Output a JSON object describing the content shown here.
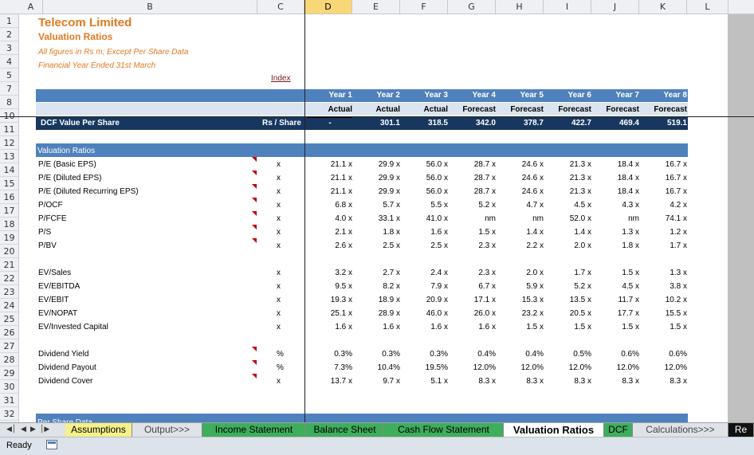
{
  "columns": [
    "A",
    "B",
    "C",
    "D",
    "E",
    "F",
    "G",
    "H",
    "I",
    "J",
    "K",
    "L"
  ],
  "rows": [
    "1",
    "2",
    "3",
    "4",
    "5",
    "7",
    "8",
    "10",
    "11",
    "12",
    "13",
    "14",
    "15",
    "16",
    "17",
    "18",
    "19",
    "20",
    "21",
    "22",
    "23",
    "24",
    "25",
    "26",
    "27",
    "28",
    "29",
    "30",
    "31",
    "32"
  ],
  "header": {
    "company": "Telecom Limited",
    "subtitle": "Valuation Ratios",
    "note1": "All figures in Rs m; Except Per Share Data",
    "note2": "Financial Year Ended 31st March",
    "index_link": "Index"
  },
  "years": [
    "Year 1",
    "Year 2",
    "Year 3",
    "Year 4",
    "Year 5",
    "Year 6",
    "Year 7",
    "Year 8"
  ],
  "types": [
    "Actual",
    "Actual",
    "Actual",
    "Forecast",
    "Forecast",
    "Forecast",
    "Forecast",
    "Forecast"
  ],
  "dcf": {
    "label": "DCF Value Per Share",
    "unit": "Rs / Share",
    "values": [
      "-",
      "301.1",
      "318.5",
      "342.0",
      "378.7",
      "422.7",
      "469.4",
      "519.1"
    ]
  },
  "section1": "Valuation Ratios",
  "section2": "Per Share Data",
  "ratios": [
    {
      "label": "P/E (Basic EPS)",
      "unit": "x",
      "values": [
        "21.1 x",
        "29.9 x",
        "56.0 x",
        "28.7 x",
        "24.6 x",
        "21.3 x",
        "18.4 x",
        "16.7 x"
      ]
    },
    {
      "label": "P/E (Diluted EPS)",
      "unit": "x",
      "values": [
        "21.1 x",
        "29.9 x",
        "56.0 x",
        "28.7 x",
        "24.6 x",
        "21.3 x",
        "18.4 x",
        "16.7 x"
      ]
    },
    {
      "label": "P/E (Diluted Recurring EPS)",
      "unit": "x",
      "values": [
        "21.1 x",
        "29.9 x",
        "56.0 x",
        "28.7 x",
        "24.6 x",
        "21.3 x",
        "18.4 x",
        "16.7 x"
      ]
    },
    {
      "label": "P/OCF",
      "unit": "x",
      "values": [
        "6.8 x",
        "5.7 x",
        "5.5 x",
        "5.2 x",
        "4.7 x",
        "4.5 x",
        "4.3 x",
        "4.2 x"
      ]
    },
    {
      "label": "P/FCFE",
      "unit": "x",
      "values": [
        "4.0 x",
        "33.1 x",
        "41.0 x",
        "nm",
        "nm",
        "52.0 x",
        "nm",
        "74.1 x"
      ]
    },
    {
      "label": "P/S",
      "unit": "x",
      "values": [
        "2.1 x",
        "1.8 x",
        "1.6 x",
        "1.5 x",
        "1.4 x",
        "1.4 x",
        "1.3 x",
        "1.2 x"
      ]
    },
    {
      "label": "P/BV",
      "unit": "x",
      "values": [
        "2.6 x",
        "2.5 x",
        "2.5 x",
        "2.3 x",
        "2.2 x",
        "2.0 x",
        "1.8 x",
        "1.7 x"
      ]
    },
    {
      "label": "EV/Sales",
      "unit": "x",
      "values": [
        "3.2 x",
        "2.7 x",
        "2.4 x",
        "2.3 x",
        "2.0 x",
        "1.7 x",
        "1.5 x",
        "1.3 x"
      ]
    },
    {
      "label": "EV/EBITDA",
      "unit": "x",
      "values": [
        "9.5 x",
        "8.2 x",
        "7.9 x",
        "6.7 x",
        "5.9 x",
        "5.2 x",
        "4.5 x",
        "3.8 x"
      ]
    },
    {
      "label": "EV/EBIT",
      "unit": "x",
      "values": [
        "19.3 x",
        "18.9 x",
        "20.9 x",
        "17.1 x",
        "15.3 x",
        "13.5 x",
        "11.7 x",
        "10.2 x"
      ]
    },
    {
      "label": "EV/NOPAT",
      "unit": "x",
      "values": [
        "25.1 x",
        "28.9 x",
        "46.0 x",
        "26.0 x",
        "23.2 x",
        "20.5 x",
        "17.7 x",
        "15.5 x"
      ]
    },
    {
      "label": "EV/Invested Capital",
      "unit": "x",
      "values": [
        "1.6 x",
        "1.6 x",
        "1.6 x",
        "1.6 x",
        "1.5 x",
        "1.5 x",
        "1.5 x",
        "1.5 x"
      ]
    },
    {
      "label": "Dividend Yield",
      "unit": "%",
      "values": [
        "0.3%",
        "0.3%",
        "0.3%",
        "0.4%",
        "0.4%",
        "0.5%",
        "0.6%",
        "0.6%"
      ]
    },
    {
      "label": "Dividend Payout",
      "unit": "%",
      "values": [
        "7.3%",
        "10.4%",
        "19.5%",
        "12.0%",
        "12.0%",
        "12.0%",
        "12.0%",
        "12.0%"
      ]
    },
    {
      "label": "Dividend Cover",
      "unit": "x",
      "values": [
        "13.7 x",
        "9.7 x",
        "5.1 x",
        "8.3 x",
        "8.3 x",
        "8.3 x",
        "8.3 x",
        "8.3 x"
      ]
    }
  ],
  "tabs": [
    {
      "label": "Assumptions",
      "bg": "#f5f08a"
    },
    {
      "label": "Output>>>",
      "bg": "#dfe3e8"
    },
    {
      "label": "Income Statement",
      "bg": "#3fae5c"
    },
    {
      "label": "Balance Sheet",
      "bg": "#3fae5c"
    },
    {
      "label": "Cash Flow Statement",
      "bg": "#3fae5c"
    },
    {
      "label": "Valuation Ratios",
      "bg": "#ffffff"
    },
    {
      "label": "DCF",
      "bg": "#3fae5c"
    },
    {
      "label": "Calculations>>>",
      "bg": "#dfe3e8"
    },
    {
      "label": "Re",
      "bg": "#111111"
    }
  ],
  "status": {
    "ready": "Ready"
  },
  "colors": {
    "band": "#4f81bd",
    "band_light": "#dbe5f1",
    "dark_band": "#17375e",
    "accent": "#e07a22"
  }
}
